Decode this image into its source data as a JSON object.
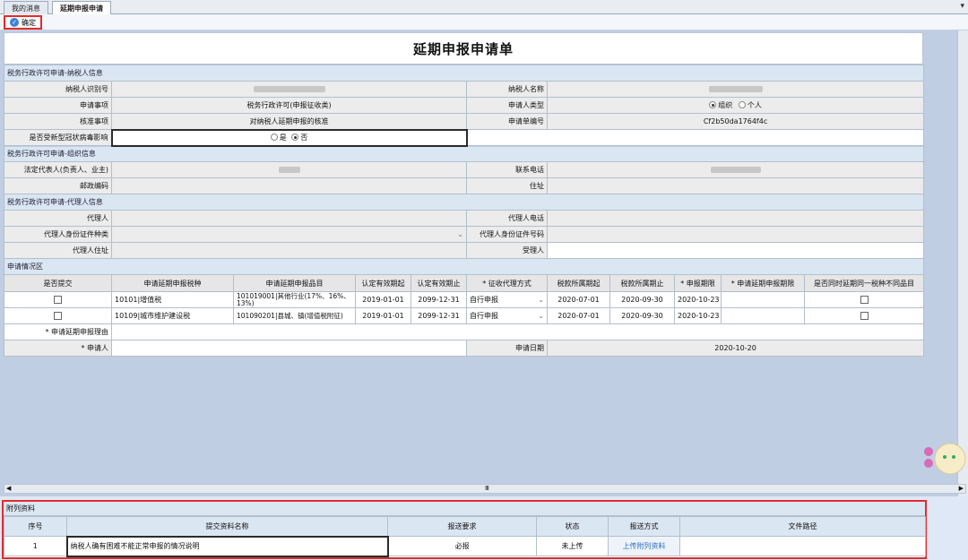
{
  "tabs": [
    {
      "label": "我的消息"
    },
    {
      "label": "延期申报申请"
    }
  ],
  "toolbar": {
    "confirm_label": "确定"
  },
  "form": {
    "title": "延期申报申请单",
    "sec1": "税务行政许可申请-纳税人信息",
    "taxpayer_id_label": "纳税人识别号",
    "taxpayer_name_label": "纳税人名称",
    "apply_item_label": "申请事项",
    "apply_item_value": "税务行政许可(申报征收类)",
    "applicant_type_label": "申请人类型",
    "applicant_type_opt1": "组织",
    "applicant_type_opt2": "个人",
    "approve_item_label": "核准事项",
    "approve_item_value": "对纳税人延期申报的核准",
    "app_no_label": "申请单编号",
    "app_no_value": "Cf2b50da1764f4c",
    "covid_label": "是否受新型冠状病毒影响",
    "covid_yes": "是",
    "covid_no": "否",
    "sec2": "税务行政许可申请-组织信息",
    "legal_rep_label": "法定代表人(负责人、业主)",
    "phone_label": "联系电话",
    "postcode_label": "邮政编码",
    "address_label": "住址",
    "sec3": "税务行政许可申请-代理人信息",
    "agent_label": "代理人",
    "agent_phone_label": "代理人电话",
    "agent_id_type_label": "代理人身份证件种类",
    "agent_id_no_label": "代理人身份证件号码",
    "agent_addr_label": "代理人住址",
    "receiver_label": "受理人",
    "sec4": "申请情况区",
    "columns": [
      "是否提交",
      "申请延期申报税种",
      "申请延期申报品目",
      "认定有效期起",
      "认定有效期止",
      "* 征收代理方式",
      "税款所属期起",
      "税款所属期止",
      "* 申报期限",
      "* 申请延期申报期限",
      "是否同时延期同一税种不同品目"
    ],
    "rows": [
      {
        "tax": "10101|增值税",
        "item": "101019001|其他行业(17%、16%、13%)",
        "valid_from": "2019-01-01",
        "valid_to": "2099-12-31",
        "mode": "自行申报",
        "period_from": "2020-07-01",
        "period_to": "2020-09-30",
        "deadline": "2020-10-23"
      },
      {
        "tax": "10109|城市维护建设税",
        "item": "101090201|县城、镇(增值税附征)",
        "valid_from": "2019-01-01",
        "valid_to": "2099-12-31",
        "mode": "自行申报",
        "period_from": "2020-07-01",
        "period_to": "2020-09-30",
        "deadline": "2020-10-23"
      }
    ],
    "reason_label": "* 申请延期申报理由",
    "applicant_label": "* 申请人",
    "apply_date_label": "申请日期",
    "apply_date_value": "2020-10-20"
  },
  "attachments": {
    "title": "附列资料",
    "columns": [
      "序号",
      "提交资料名称",
      "报送要求",
      "状态",
      "报送方式",
      "文件路径"
    ],
    "rows": [
      {
        "no": "1",
        "name": "纳税人确有困难不能正常申报的情况说明",
        "req": "必报",
        "status": "未上传",
        "method": "上传附列资料",
        "path": ""
      }
    ]
  },
  "scroll": {
    "left_arrow": "◀",
    "right_arrow": "▶",
    "grip": "Ⅲ"
  },
  "colors": {
    "highlight": "#e32b2b",
    "section_bg": "#dbe6f3",
    "link": "#2b6fc7"
  }
}
